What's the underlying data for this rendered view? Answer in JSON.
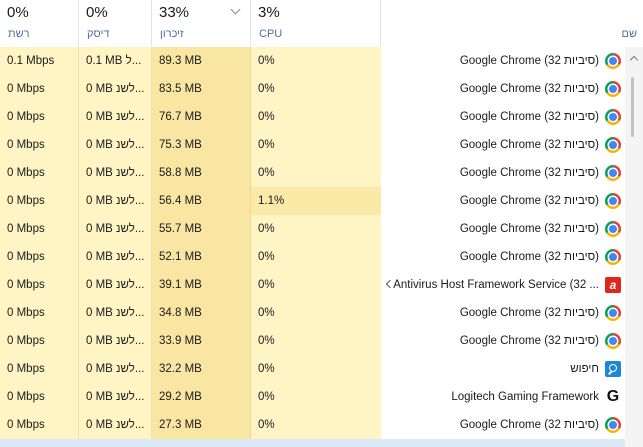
{
  "columns": {
    "network": {
      "percent": "0%",
      "label": "רשת"
    },
    "disk": {
      "percent": "0%",
      "label": "דיסק"
    },
    "memory": {
      "percent": "33%",
      "label": "זיכרון"
    },
    "cpu": {
      "percent": "3%",
      "label": "CPU"
    },
    "name": {
      "label": "שם"
    }
  },
  "rows": [
    {
      "name": "Google Chrome (32 סיביות)",
      "icon": "chrome-icon",
      "cpu": "0%",
      "memory": "89.3 MB",
      "disk": "0.1 MB ל...",
      "network": "0.1 Mbps"
    },
    {
      "name": "Google Chrome (32 סיביות)",
      "icon": "chrome-icon",
      "cpu": "0%",
      "memory": "83.5 MB",
      "disk": "0 MB לשנ...",
      "network": "0 Mbps"
    },
    {
      "name": "Google Chrome (32 סיביות)",
      "icon": "chrome-icon",
      "cpu": "0%",
      "memory": "76.7 MB",
      "disk": "0 MB לשנ...",
      "network": "0 Mbps"
    },
    {
      "name": "Google Chrome (32 סיביות)",
      "icon": "chrome-icon",
      "cpu": "0%",
      "memory": "75.3 MB",
      "disk": "0 MB לשנ...",
      "network": "0 Mbps"
    },
    {
      "name": "Google Chrome (32 סיביות)",
      "icon": "chrome-icon",
      "cpu": "0%",
      "memory": "58.8 MB",
      "disk": "0 MB לשנ...",
      "network": "0 Mbps"
    },
    {
      "name": "Google Chrome (32 סיביות)",
      "icon": "chrome-icon",
      "cpu": "1.1%",
      "memory": "56.4 MB",
      "disk": "0 MB לשנ...",
      "network": "0 Mbps"
    },
    {
      "name": "Google Chrome (32 סיביות)",
      "icon": "chrome-icon",
      "cpu": "0%",
      "memory": "55.7 MB",
      "disk": "0 MB לשנ...",
      "network": "0 Mbps"
    },
    {
      "name": "Google Chrome (32 סיביות)",
      "icon": "chrome-icon",
      "cpu": "0%",
      "memory": "52.1 MB",
      "disk": "0 MB לשנ...",
      "network": "0 Mbps"
    },
    {
      "name": "Antivirus Host Framework Service (32 ...",
      "icon": "avira-icon",
      "cpu": "0%",
      "memory": "39.1 MB",
      "disk": "0 MB לשנ...",
      "network": "0 Mbps",
      "expandable": true
    },
    {
      "name": "Google Chrome (32 סיביות)",
      "icon": "chrome-icon",
      "cpu": "0%",
      "memory": "34.8 MB",
      "disk": "0 MB לשנ...",
      "network": "0 Mbps"
    },
    {
      "name": "Google Chrome (32 סיביות)",
      "icon": "chrome-icon",
      "cpu": "0%",
      "memory": "33.9 MB",
      "disk": "0 MB לשנ...",
      "network": "0 Mbps"
    },
    {
      "name": "חיפוש",
      "icon": "search-icon",
      "cpu": "0%",
      "memory": "32.2 MB",
      "disk": "0 MB לשנ...",
      "network": "0 Mbps"
    },
    {
      "name": "Logitech Gaming Framework",
      "icon": "logitech-icon",
      "cpu": "0%",
      "memory": "29.2 MB",
      "disk": "0 MB לשנ...",
      "network": "0 Mbps"
    },
    {
      "name": "Google Chrome (32 סיביות)",
      "icon": "chrome-icon",
      "cpu": "0%",
      "memory": "27.3 MB",
      "disk": "0 MB לשנ...",
      "network": "0 Mbps"
    }
  ]
}
